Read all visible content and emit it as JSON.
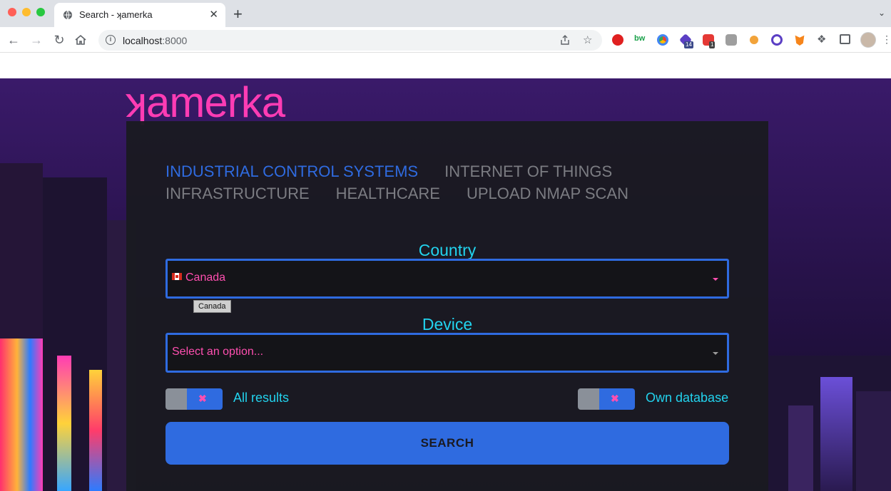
{
  "browser": {
    "tab_title": "Search - ʞamerka",
    "new_tab_label": "+",
    "tab_close_label": "✕",
    "url_host": "localhost",
    "url_port": ":8000",
    "extensions": [
      {
        "name": "adblock-icon",
        "color": "#e02020"
      },
      {
        "name": "bw-icon",
        "color": "#1aa14a"
      },
      {
        "name": "chrome-ext-icon",
        "color": "#4285f4"
      },
      {
        "name": "graduation-ext-icon",
        "color": "#5b3fc4",
        "badge": "14"
      },
      {
        "name": "calendar-ext-icon",
        "color": "#e53935",
        "badge": "1"
      },
      {
        "name": "briefcase-ext-icon",
        "color": "#9e9e9e"
      },
      {
        "name": "cookie-ext-icon",
        "color": "#f2a33a"
      },
      {
        "name": "robot-ext-icon",
        "color": "#5b3fc4"
      },
      {
        "name": "metamask-icon",
        "color": "#f6851b"
      }
    ]
  },
  "app": {
    "logo": "ʞamerka",
    "tabs": [
      {
        "label": "INDUSTRIAL CONTROL SYSTEMS",
        "active": true
      },
      {
        "label": "INTERNET OF THINGS",
        "active": false
      },
      {
        "label": "INFRASTRUCTURE",
        "active": false
      },
      {
        "label": "HEALTHCARE",
        "active": false
      },
      {
        "label": "UPLOAD NMAP SCAN",
        "active": false
      }
    ],
    "country": {
      "label": "Country",
      "value": "Canada",
      "tooltip": "Canada"
    },
    "device": {
      "label": "Device",
      "placeholder": "Select an option..."
    },
    "toggles": {
      "all_results": {
        "label": "All results",
        "mark": "✖"
      },
      "own_database": {
        "label": "Own database",
        "mark": "✖"
      }
    },
    "search_button": "SEARCH"
  },
  "colors": {
    "accent_blue": "#2f6be0",
    "pink": "#ff3cb4",
    "cyan": "#22d3ee"
  }
}
